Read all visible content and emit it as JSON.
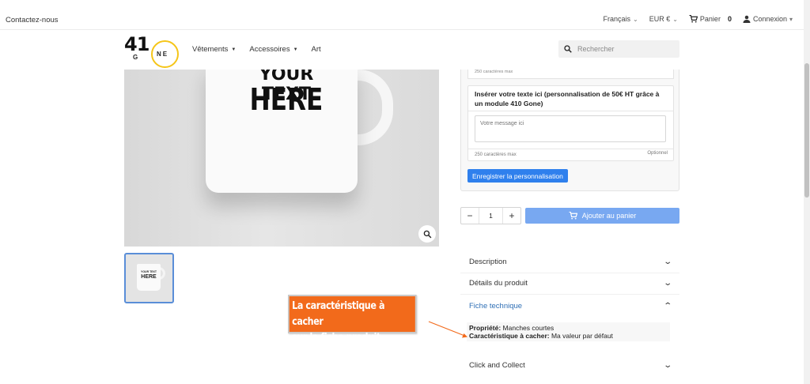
{
  "topbar": {
    "contact": "Contactez-nous",
    "language": "Français",
    "currency": "EUR €",
    "cart_label": "Panier",
    "cart_count": "0",
    "login": "Connexion"
  },
  "header": {
    "logo_number": "41",
    "logo_g": "G",
    "logo_ne": "NE",
    "nav": [
      {
        "label": "Vêtements"
      },
      {
        "label": "Accessoires"
      },
      {
        "label": "Art"
      }
    ],
    "search_placeholder": "Rechercher"
  },
  "product_image": {
    "line1": "YOUR TEXT",
    "line2": "HERE"
  },
  "thumbnail": {
    "line1": "YOUR TEXT",
    "line2": "HERE"
  },
  "customization": {
    "top_field_counter": "250 caractères max",
    "field_label": "Insérer votre texte ici (personnalisation de 50€ HT grâce à un module 410 Gone)",
    "field_placeholder": "Votre message ici",
    "field_max": "250 caractères max",
    "field_optional": "Optionnel",
    "save_button": "Enregistrer la personnalisation"
  },
  "purchase": {
    "quantity": "1",
    "minus": "−",
    "plus": "+",
    "add_to_cart": "Ajouter au panier"
  },
  "accordion": [
    {
      "label": "Description",
      "open": false
    },
    {
      "label": "Détails du produit",
      "open": false
    },
    {
      "label": "Fiche technique",
      "open": true
    },
    {
      "label": "Click and Collect",
      "open": false
    }
  ],
  "specs": {
    "prop1_label": "Propriété:",
    "prop1_value": "Manches courtes",
    "prop2_label": "Caractéristique à cacher:",
    "prop2_value": "Ma valeur par défaut"
  },
  "annotation": {
    "line1": "La caractéristique à cacher",
    "line2": "sur la fiche produit",
    "color": "#f26a1b"
  },
  "colors": {
    "accent": "#2f80ed",
    "add_to_cart": "#78a8f1",
    "logo_ring": "#f5c518",
    "active_tab": "#2f6fb5"
  }
}
